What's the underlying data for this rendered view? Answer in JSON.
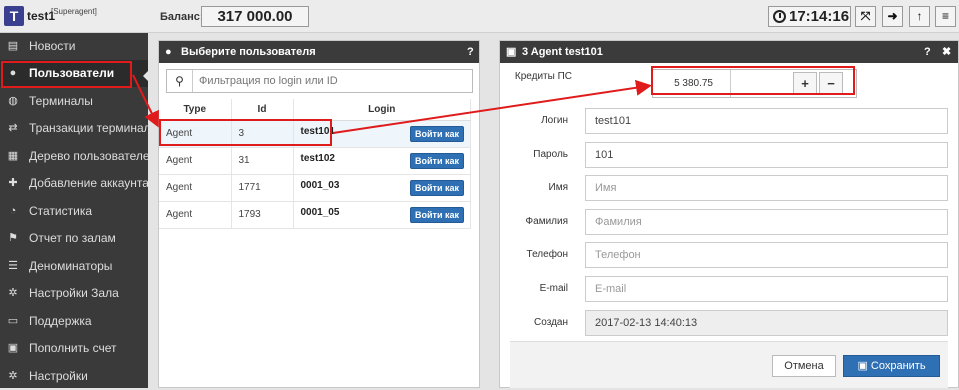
{
  "app": {
    "logo_letter": "T",
    "username": "test1",
    "role": "[Superagent]"
  },
  "header": {
    "balance_label": "Баланс:",
    "balance_value": "317 000.00",
    "clock": "17:14:16",
    "accent": "#3a3f8f"
  },
  "sidebar": {
    "items": [
      {
        "label": "Новости",
        "icon": "newspaper-icon"
      },
      {
        "label": "Пользователи",
        "icon": "users-icon",
        "active": true
      },
      {
        "label": "Терминалы",
        "icon": "gamepad-icon"
      },
      {
        "label": "Транзакции терминалов",
        "icon": "exchange-icon"
      },
      {
        "label": "Дерево пользователей",
        "icon": "sitemap-icon"
      },
      {
        "label": "Добавление аккаунта",
        "icon": "user-plus-icon"
      },
      {
        "label": "Статистика",
        "icon": "pie-chart-icon"
      },
      {
        "label": "Отчет по залам",
        "icon": "flag-icon"
      },
      {
        "label": "Деноминаторы",
        "icon": "database-icon"
      },
      {
        "label": "Настройки Зала",
        "icon": "gear-icon"
      },
      {
        "label": "Поддержка",
        "icon": "inbox-icon"
      },
      {
        "label": "Пополнить счет",
        "icon": "money-icon"
      },
      {
        "label": "Настройки",
        "icon": "gears-icon"
      }
    ]
  },
  "users_panel": {
    "title": "Выберите пользователя",
    "help": "?",
    "filter_placeholder": "Фильтрация по login или ID",
    "columns": [
      "Type",
      "Id",
      "Login"
    ],
    "login_as_label": "Войти как",
    "rows": [
      {
        "type": "Agent",
        "id": "3",
        "login": "test101",
        "selected": true
      },
      {
        "type": "Agent",
        "id": "31",
        "login": "test102"
      },
      {
        "type": "Agent",
        "id": "1771",
        "login": "0001_03"
      },
      {
        "type": "Agent",
        "id": "1793",
        "login": "0001_05"
      }
    ]
  },
  "detail_panel": {
    "title": "3 Agent test101",
    "help": "?",
    "close": "✖",
    "credits_label": "Кредиты ПС",
    "credits_value": "5 380.75",
    "plus": "+",
    "minus": "−",
    "fields": [
      {
        "label": "Логин",
        "value": "test101"
      },
      {
        "label": "Пароль",
        "value": "101"
      },
      {
        "label": "Имя",
        "placeholder": "Имя"
      },
      {
        "label": "Фамилия",
        "placeholder": "Фамилия"
      },
      {
        "label": "Телефон",
        "placeholder": "Телефон"
      },
      {
        "label": "E-mail",
        "placeholder": "E-mail"
      },
      {
        "label": "Создан",
        "value": "2017-02-13 14:40:13",
        "readonly": true
      }
    ],
    "cancel_label": "Отмена",
    "save_label": "Сохранить"
  },
  "colors": {
    "sidebar_bg": "#3a3a3a",
    "primary_button": "#2f6fb4",
    "annotation_red": "#e01b1b"
  }
}
